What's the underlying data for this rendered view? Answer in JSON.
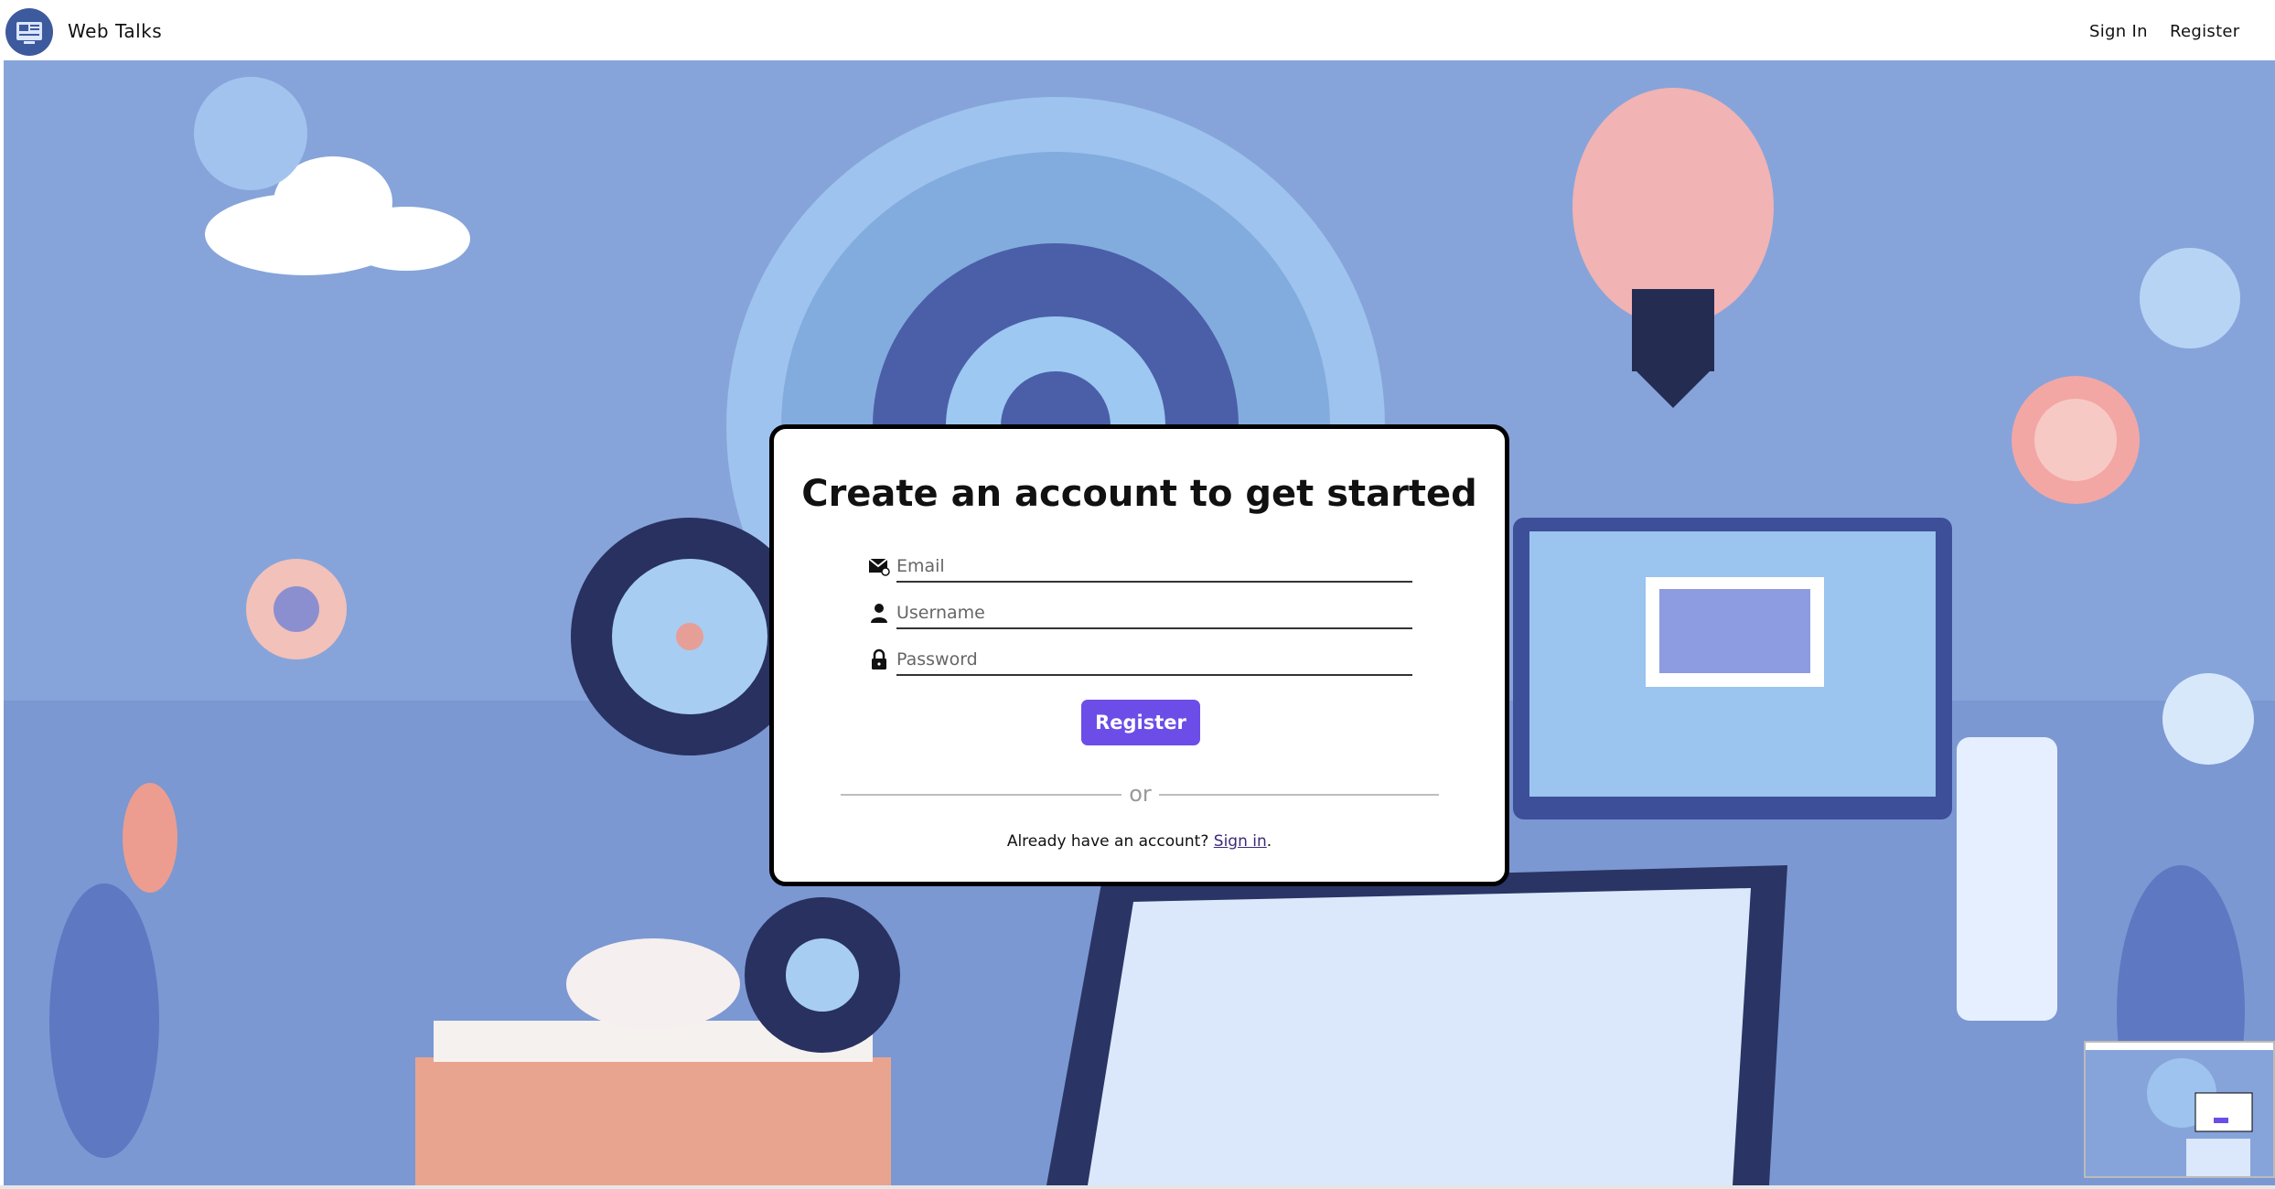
{
  "header": {
    "brand": "Web Talks",
    "nav": {
      "sign_in": "Sign In",
      "register": "Register"
    }
  },
  "card": {
    "title": "Create an account to get started",
    "fields": {
      "email_placeholder": "Email",
      "username_placeholder": "Username",
      "password_placeholder": "Password"
    },
    "submit_label": "Register",
    "divider_text": "or",
    "signin_prompt": "Already have an account?",
    "signin_link": "Sign in",
    "signin_suffix": "."
  },
  "icons": {
    "logo": "web-talks-logo",
    "email": "envelope-icon",
    "username": "user-icon",
    "password": "lock-icon"
  },
  "colors": {
    "accent": "#6c4de8",
    "hero_background": "#7f9fd8",
    "link": "#3b2b7a"
  }
}
